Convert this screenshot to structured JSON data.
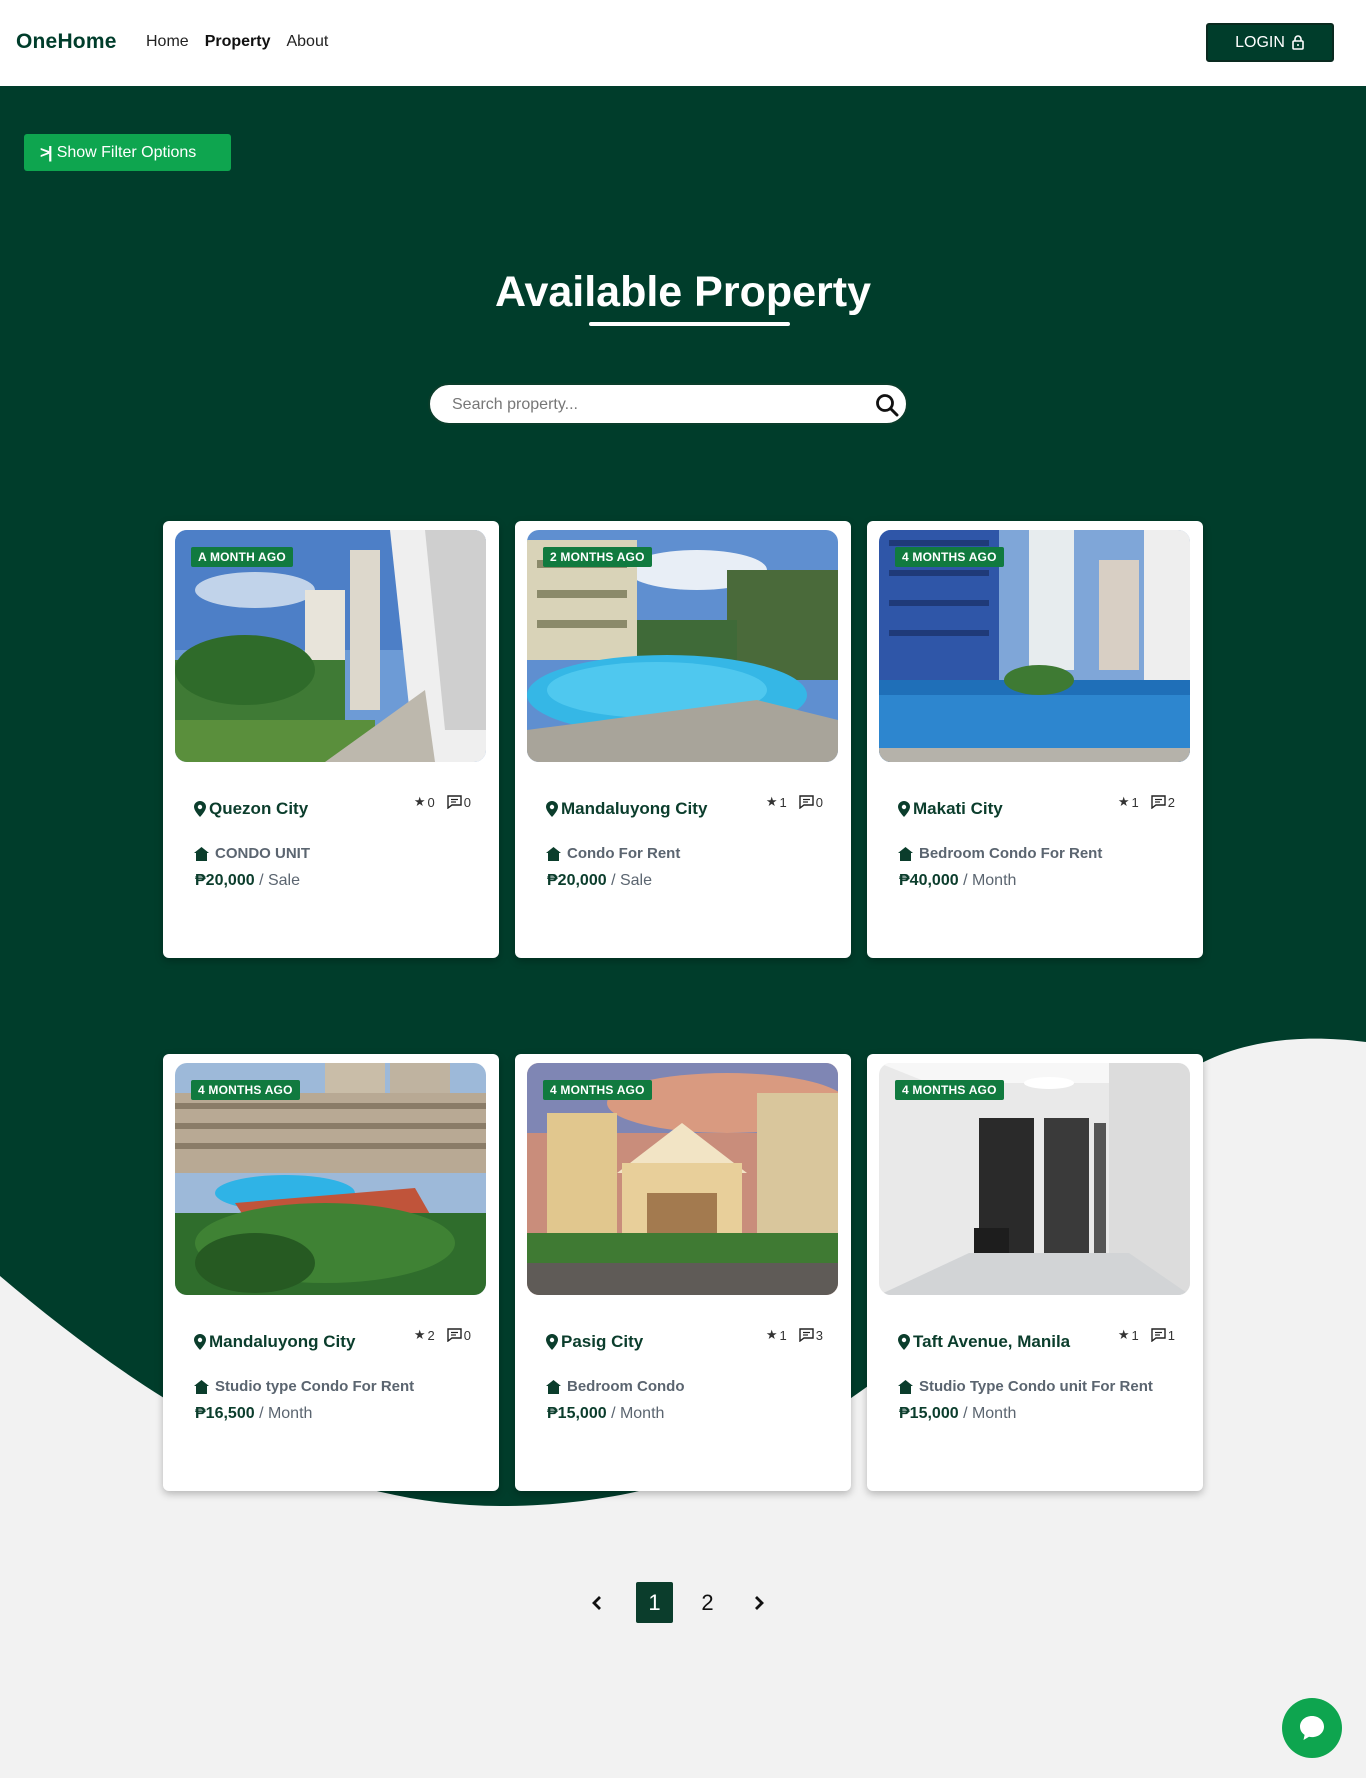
{
  "nav": {
    "brand": "OneHome",
    "links": [
      "Home",
      "Property",
      "About"
    ],
    "active": "Property",
    "login_label": "LOGIN"
  },
  "filter": {
    "label": "Show Filter Options"
  },
  "page": {
    "title": "Available Property"
  },
  "search": {
    "placeholder": "Search property..."
  },
  "listings": [
    {
      "age": "A MONTH AGO",
      "location": "Quezon City",
      "stars": "0",
      "comments": "0",
      "type": "CONDO UNIT",
      "price": "₱20,000",
      "term": "/ Sale"
    },
    {
      "age": "2 MONTHS AGO",
      "location": "Mandaluyong City",
      "stars": "1",
      "comments": "0",
      "type": "Condo For Rent",
      "price": "₱20,000",
      "term": "/ Sale"
    },
    {
      "age": "4 MONTHS AGO",
      "location": "Makati City",
      "stars": "1",
      "comments": "2",
      "type": "Bedroom Condo For Rent",
      "price": "₱40,000",
      "term": "/ Month"
    },
    {
      "age": "4 MONTHS AGO",
      "location": "Mandaluyong City",
      "stars": "2",
      "comments": "0",
      "type": "Studio type Condo For Rent",
      "price": "₱16,500",
      "term": "/ Month"
    },
    {
      "age": "4 MONTHS AGO",
      "location": "Pasig City",
      "stars": "1",
      "comments": "3",
      "type": "Bedroom Condo",
      "price": "₱15,000",
      "term": "/ Month"
    },
    {
      "age": "4 MONTHS AGO",
      "location": "Taft Avenue, Manila",
      "stars": "1",
      "comments": "1",
      "type": "Studio Type Condo unit For Rent",
      "price": "₱15,000",
      "term": "/ Month"
    }
  ],
  "pagination": {
    "pages": [
      "1",
      "2"
    ],
    "current": "1"
  },
  "colors": {
    "primary": "#003d2b",
    "accent": "#0ea54f",
    "badge": "#117a3f",
    "background": "#f2f2f2"
  }
}
